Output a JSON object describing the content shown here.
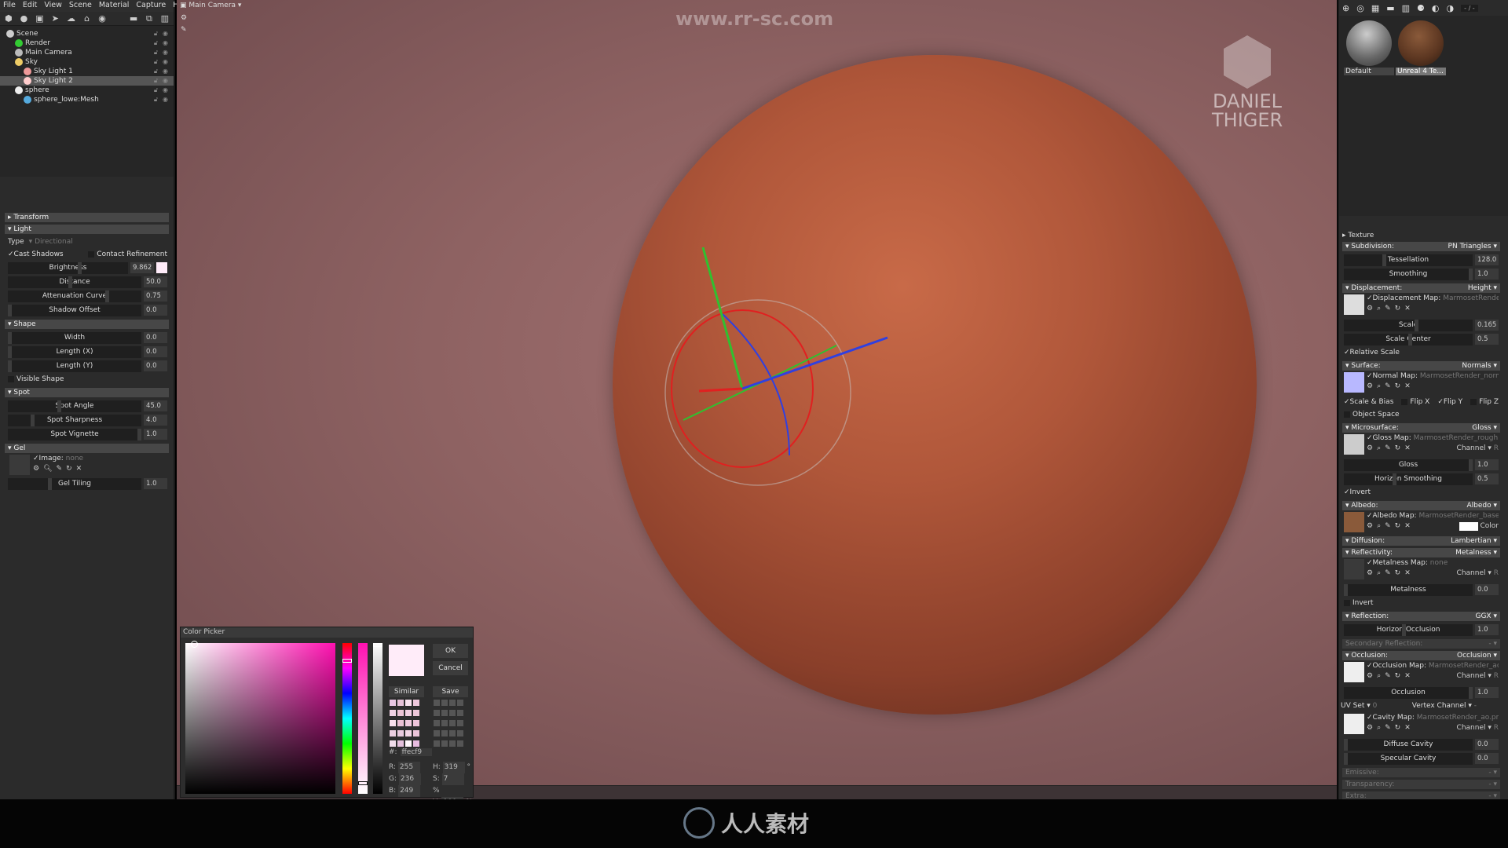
{
  "menu": [
    "File",
    "Edit",
    "View",
    "Scene",
    "Material",
    "Capture",
    "Help"
  ],
  "tree": [
    {
      "label": "Scene",
      "indent": 0,
      "color": "#ccc"
    },
    {
      "label": "Render",
      "indent": 1,
      "color": "#3c3"
    },
    {
      "label": "Main Camera",
      "indent": 1,
      "color": "#bbb"
    },
    {
      "label": "Sky",
      "indent": 1,
      "color": "#ec6"
    },
    {
      "label": "Sky Light 1",
      "indent": 2,
      "color": "#e99"
    },
    {
      "label": "Sky Light 2",
      "indent": 2,
      "color": "#fcc",
      "selected": true
    },
    {
      "label": "sphere",
      "indent": 1,
      "color": "#eee"
    },
    {
      "label": "sphere_lowe:Mesh",
      "indent": 2,
      "color": "#5ad"
    }
  ],
  "props": {
    "transform": "Transform",
    "light": "Light",
    "type_label": "Type",
    "type_value": "Directional",
    "cast_shadows": "Cast Shadows",
    "contact_refinement": "Contact Refinement",
    "brightness": {
      "label": "Brightness",
      "value": "9.862"
    },
    "distance": {
      "label": "Distance",
      "value": "50.0"
    },
    "attenuation": {
      "label": "Attenuation Curve",
      "value": "0.75"
    },
    "shadow_offset": {
      "label": "Shadow Offset",
      "value": "0.0"
    },
    "shape": "Shape",
    "width": {
      "label": "Width",
      "value": "0.0"
    },
    "length_x": {
      "label": "Length (X)",
      "value": "0.0"
    },
    "length_y": {
      "label": "Length (Y)",
      "value": "0.0"
    },
    "visible_shape": "Visible Shape",
    "spot": "Spot",
    "spot_angle": {
      "label": "Spot Angle",
      "value": "45.0"
    },
    "spot_sharpness": {
      "label": "Spot Sharpness",
      "value": "4.0"
    },
    "spot_vignette": {
      "label": "Spot Vignette",
      "value": "1.0"
    },
    "gel": "Gel",
    "image_label": "Image:",
    "image_value": "none",
    "gel_tiling": {
      "label": "Gel Tiling",
      "value": "1.0"
    }
  },
  "viewport": {
    "camera": "Main Camera",
    "watermark_url": "www.rr-sc.com",
    "logo_line1": "DANIEL",
    "logo_line2": "THIGER"
  },
  "materials": [
    {
      "label": "Default"
    },
    {
      "label": "Unreal 4 Te..."
    }
  ],
  "mat_counter": "- / -",
  "material": {
    "texture": "Texture",
    "subdivision": {
      "label": "Subdivision:",
      "mode": "PN Triangles"
    },
    "tessellation": {
      "label": "Tessellation",
      "value": "128.0"
    },
    "smoothing": {
      "label": "Smoothing",
      "value": "1.0"
    },
    "displacement": {
      "label": "Displacement:",
      "mode": "Height",
      "map_label": "Displacement Map:",
      "map_value": "MarmosetRender_he"
    },
    "scale": {
      "label": "Scale",
      "value": "0.165"
    },
    "scale_center": {
      "label": "Scale Center",
      "value": "0.5"
    },
    "relative_scale": "Relative Scale",
    "surface": {
      "label": "Surface:",
      "mode": "Normals",
      "map_label": "Normal Map:",
      "map_value": "MarmosetRender_normal.p"
    },
    "scale_bias": "Scale & Bias",
    "flip_x": "Flip X",
    "flip_y": "Flip Y",
    "flip_z": "Flip Z",
    "object_space": "Object Space",
    "microsurface": {
      "label": "Microsurface:",
      "mode": "Gloss",
      "map_label": "Gloss Map:",
      "map_value": "MarmosetRender_roughness"
    },
    "channel": "Channel",
    "channel_value": "R",
    "gloss": {
      "label": "Gloss",
      "value": "1.0"
    },
    "horizon_smoothing": {
      "label": "Horizon Smoothing",
      "value": "0.5"
    },
    "invert": "Invert",
    "albedo": {
      "label": "Albedo:",
      "mode": "Albedo",
      "map_label": "Albedo Map:",
      "map_value": "MarmosetRender_basecolo"
    },
    "color": "Color",
    "diffusion": {
      "label": "Diffusion:",
      "mode": "Lambertian"
    },
    "reflectivity": {
      "label": "Reflectivity:",
      "mode": "Metalness",
      "map_label": "Metalness Map:",
      "map_value": "none"
    },
    "metalness": {
      "label": "Metalness",
      "value": "0.0"
    },
    "reflection": {
      "label": "Reflection:",
      "mode": "GGX"
    },
    "horizon_occlusion": {
      "label": "Horizon Occlusion",
      "value": "1.0"
    },
    "secondary_reflection": {
      "label": "Secondary Reflection:",
      "mode": "-"
    },
    "occlusion": {
      "label": "Occlusion:",
      "mode": "Occlusion",
      "map_label": "Occlusion Map:",
      "map_value": "MarmosetRender_ao.pn"
    },
    "occlusion_slider": {
      "label": "Occlusion",
      "value": "1.0"
    },
    "uv_set": "UV Set",
    "uv_value": "0",
    "vertex_channel": "Vertex Channel",
    "vertex_value": "-",
    "cavity": {
      "map_label": "Cavity Map:",
      "map_value": "MarmosetRender_ao.png"
    },
    "diffuse_cavity": {
      "label": "Diffuse Cavity",
      "value": "0.0"
    },
    "specular_cavity": {
      "label": "Specular Cavity",
      "value": "0.0"
    },
    "emissive": {
      "label": "Emissive:",
      "mode": "-"
    },
    "transparency": {
      "label": "Transparency:",
      "mode": "-"
    },
    "extra": {
      "label": "Extra:",
      "mode": "-"
    }
  },
  "color_picker": {
    "title": "Color Picker",
    "ok": "OK",
    "cancel": "Cancel",
    "similar": "Similar",
    "save": "Save",
    "hex_label": "#:",
    "hex": "ffecf9",
    "r": "255",
    "g": "236",
    "b": "249",
    "h": "319",
    "s": "7",
    "v": "100",
    "current_color": "#ffecf9",
    "similar_swatches": [
      "#e8c8e4",
      "#e6c2d8",
      "#f8e2ee",
      "#eec8dc",
      "#f0d2e4",
      "#ecc4d6",
      "#f2d0e2",
      "#ecc6d8",
      "#f8e0ec",
      "#eac0d4",
      "#f0cade",
      "#eec4da",
      "#ecd0e2",
      "#e8cade",
      "#f2d6e6",
      "#ecc6da",
      "#f0dcea",
      "#e4c0dc",
      "#fff6fb",
      "#e8bce0"
    ]
  },
  "bottom_logo": "人人素材"
}
